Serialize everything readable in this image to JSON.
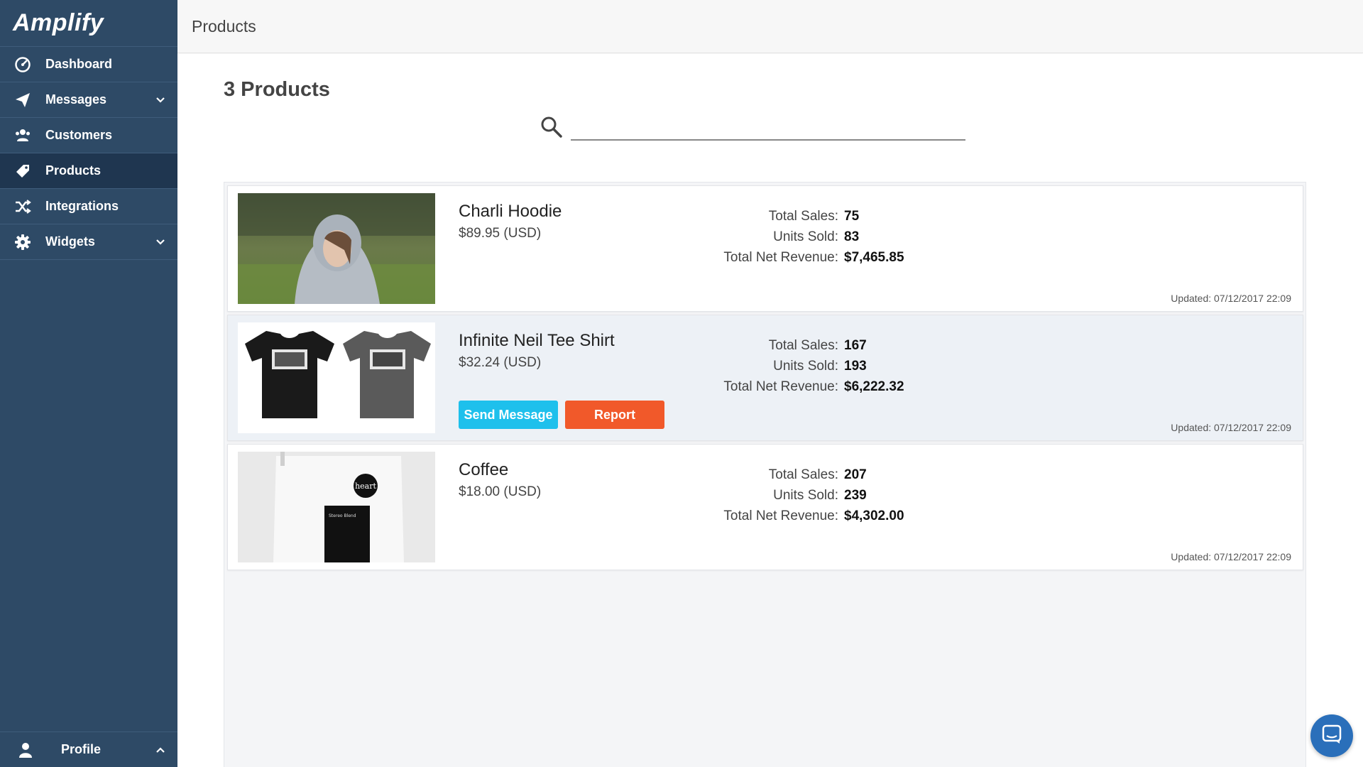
{
  "brand": {
    "name": "Amplify"
  },
  "sidebar": {
    "items": [
      {
        "label": "Dashboard",
        "icon": "dashboard-gauge-icon"
      },
      {
        "label": "Messages",
        "icon": "paper-plane-icon",
        "has_submenu": true
      },
      {
        "label": "Customers",
        "icon": "users-icon"
      },
      {
        "label": "Products",
        "icon": "tag-icon",
        "active": true
      },
      {
        "label": "Integrations",
        "icon": "shuffle-icon"
      },
      {
        "label": "Widgets",
        "icon": "gear-icon",
        "has_submenu": true
      }
    ],
    "profile": {
      "label": "Profile",
      "icon": "user-icon"
    }
  },
  "header": {
    "title": "Products"
  },
  "main": {
    "count_title": "3 Products",
    "search": {
      "value": "",
      "placeholder": ""
    }
  },
  "products": [
    {
      "name": "Charli Hoodie",
      "price": "$89.95 (USD)",
      "total_sales_label": "Total Sales:",
      "total_sales": "75",
      "units_sold_label": "Units Sold:",
      "units_sold": "83",
      "revenue_label": "Total Net Revenue:",
      "revenue": "$7,465.85",
      "updated": "Updated: 07/12/2017 22:09"
    },
    {
      "name": "Infinite Neil Tee Shirt",
      "price": "$32.24 (USD)",
      "total_sales_label": "Total Sales:",
      "total_sales": "167",
      "units_sold_label": "Units Sold:",
      "units_sold": "193",
      "revenue_label": "Total Net Revenue:",
      "revenue": "$6,222.32",
      "updated": "Updated: 07/12/2017 22:09",
      "send_message_label": "Send Message",
      "report_label": "Report"
    },
    {
      "name": "Coffee",
      "price": "$18.00 (USD)",
      "total_sales_label": "Total Sales:",
      "total_sales": "207",
      "units_sold_label": "Units Sold:",
      "units_sold": "239",
      "revenue_label": "Total Net Revenue:",
      "revenue": "$4,302.00",
      "updated": "Updated: 07/12/2017 22:09",
      "bag_label": "heart",
      "bag_blend": "Stereo Blend"
    }
  ],
  "colors": {
    "sidebar_bg": "#2e4a66",
    "sidebar_active": "#1f3650",
    "send_button": "#1ec0ec",
    "report_button": "#f1592a",
    "chat_bubble": "#2a6fba"
  },
  "chat": {
    "icon": "chat-bubble-icon"
  }
}
